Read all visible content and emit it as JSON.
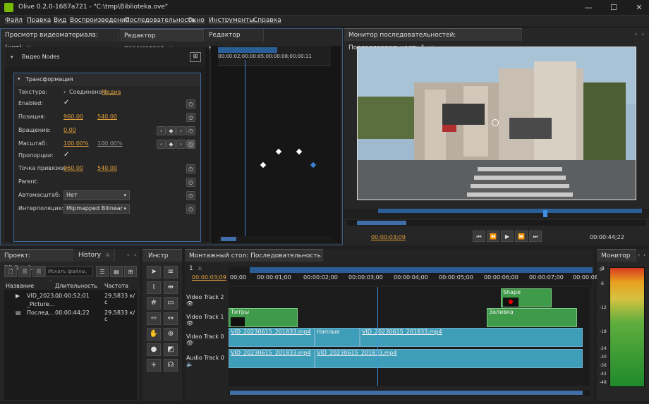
{
  "window": {
    "title": "Olive 0.2.0-1687a721 - \"C:\\tmp\\Biblioteka.ove\""
  },
  "menu": [
    "Файл",
    "Правка",
    "Вид",
    "Воспроизведение",
    "Последовательность",
    "Окно",
    "Инструменты",
    "Справка"
  ],
  "top_tabs": {
    "viewer": "Просмотр видеоматериала: (нет)",
    "params": "Редактор параметров",
    "nodes": "Редактор нод"
  },
  "params": {
    "section": "Видео Nodes",
    "group": "Трансформация",
    "texture_label": "Текстура:",
    "texture_value_prefix": "Соединено с",
    "texture_link": "Медиа",
    "enabled_label": "Enabled:",
    "position_label": "Позиция:",
    "position_x": "960.00",
    "position_y": "540.00",
    "rotation_label": "Вращение:",
    "rotation_value": "0.00",
    "scale_label": "Масштаб:",
    "scale_x": "100.00%",
    "scale_y": "100.00%",
    "proportions_label": "Пропорции:",
    "anchor_label": "Точка привязки:",
    "anchor_x": "960.00",
    "anchor_y": "540.00",
    "parent_label": "Parent:",
    "autoscale_label": "Автомасштаб:",
    "autoscale_value": "Нет",
    "interp_label": "Интерполяция:",
    "interp_value": "Mipmapped Bilinear"
  },
  "keyframe_ruler": "00:00:02;00:00:05;00:00:08;00:00:11",
  "seq_monitor": {
    "tab": "Монитор последовательностей: Последовательность 1",
    "time_current": "00:00:03;09",
    "time_total": "00:00:44;22"
  },
  "project": {
    "tab": "Проект: Biblioteka",
    "history_tab": "History",
    "search_placeholder": "Искать файлы, ...",
    "columns": [
      "Название",
      "Длительность",
      "Частота"
    ],
    "items": [
      {
        "name": "VID_2023...",
        "duration": "00:00:52;01",
        "rate": "29.5833 к/с"
      },
      {
        "name": "_Picture...",
        "duration": "",
        "rate": ""
      },
      {
        "name": "Послед...",
        "duration": "00:00:44;22",
        "rate": "29.5833 к/с"
      }
    ]
  },
  "tools_tab": "Инстр",
  "timeline": {
    "tab": "Монтажный стол: Последовательность 1",
    "timecode": "00:00:03;09",
    "ticks": [
      "00;00",
      "00:00:01;00",
      "00:00:02;00",
      "00:00:03;00",
      "00:00:04;00",
      "00:00:05;00",
      "00:00:06;00",
      "00:00:07;00",
      "00:00:08;0"
    ],
    "tracks": [
      "Video Track 2",
      "Video Track 1",
      "Video Track 0",
      "Audio Track 0"
    ],
    "clips": {
      "shape": "Shape",
      "titles": "Титры",
      "fill": "Заливка",
      "vid1": "VID_20230615_201833.mp4",
      "overlay": "Наплыв",
      "vid2": "VID_20230615_201833.mp4",
      "aud1": "VID_20230615_201833.mp4",
      "aud2": "VID_20230615_201833.mp4"
    }
  },
  "audio_monitor": {
    "tab": "Монитор з",
    "scale": [
      "0",
      "-6",
      "-12",
      "-18",
      "-24",
      "-30",
      "-36",
      "-42",
      "-48"
    ]
  }
}
